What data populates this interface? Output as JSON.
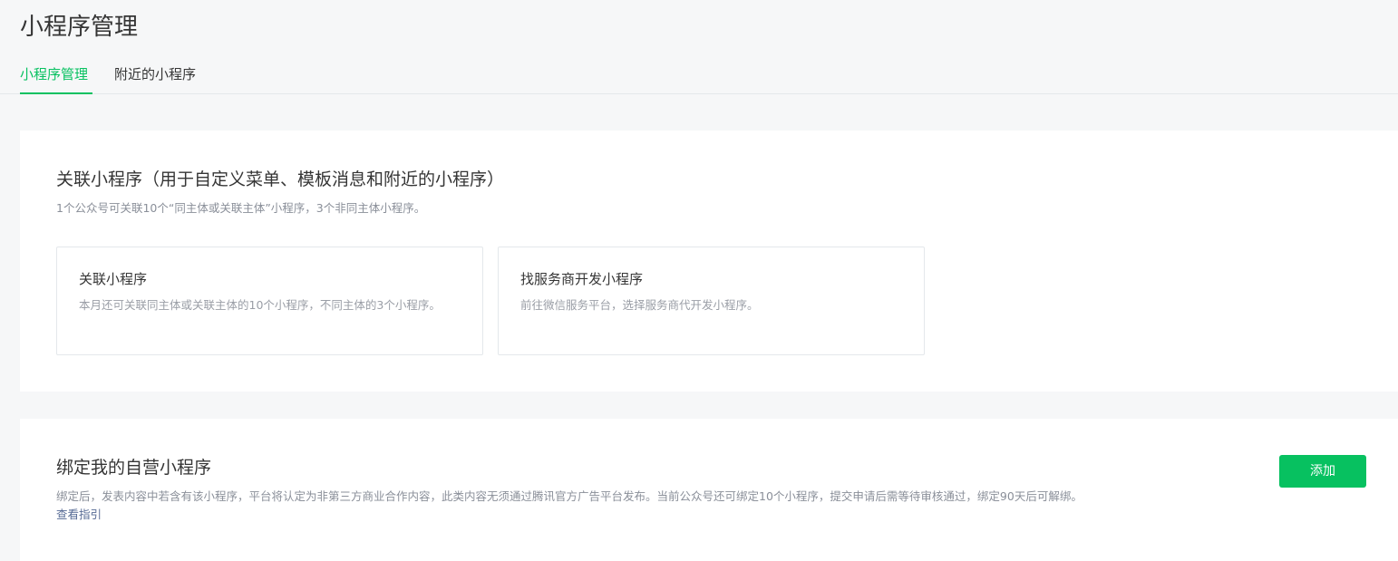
{
  "page": {
    "title": "小程序管理"
  },
  "tabs": [
    {
      "label": "小程序管理",
      "active": true
    },
    {
      "label": "附近的小程序",
      "active": false
    }
  ],
  "link_section": {
    "title": "关联小程序（用于自定义菜单、模板消息和附近的小程序）",
    "description": "1个公众号可关联10个“同主体或关联主体”小程序，3个非同主体小程序。",
    "cards": [
      {
        "title": "关联小程序",
        "description": "本月还可关联同主体或关联主体的10个小程序，不同主体的3个小程序。"
      },
      {
        "title": "找服务商开发小程序",
        "description": "前往微信服务平台，选择服务商代开发小程序。"
      }
    ]
  },
  "bind_section": {
    "title": "绑定我的自营小程序",
    "description": "绑定后，发表内容中若含有该小程序，平台将认定为非第三方商业合作内容，此类内容无须通过腾讯官方广告平台发布。当前公众号还可绑定10个小程序，提交申请后需等待审核通过，绑定90天后可解绑。",
    "guide_link": "查看指引",
    "add_button": "添加"
  },
  "colors": {
    "accent": "#07c160",
    "link": "#576b95",
    "background": "#f6f7f8"
  }
}
